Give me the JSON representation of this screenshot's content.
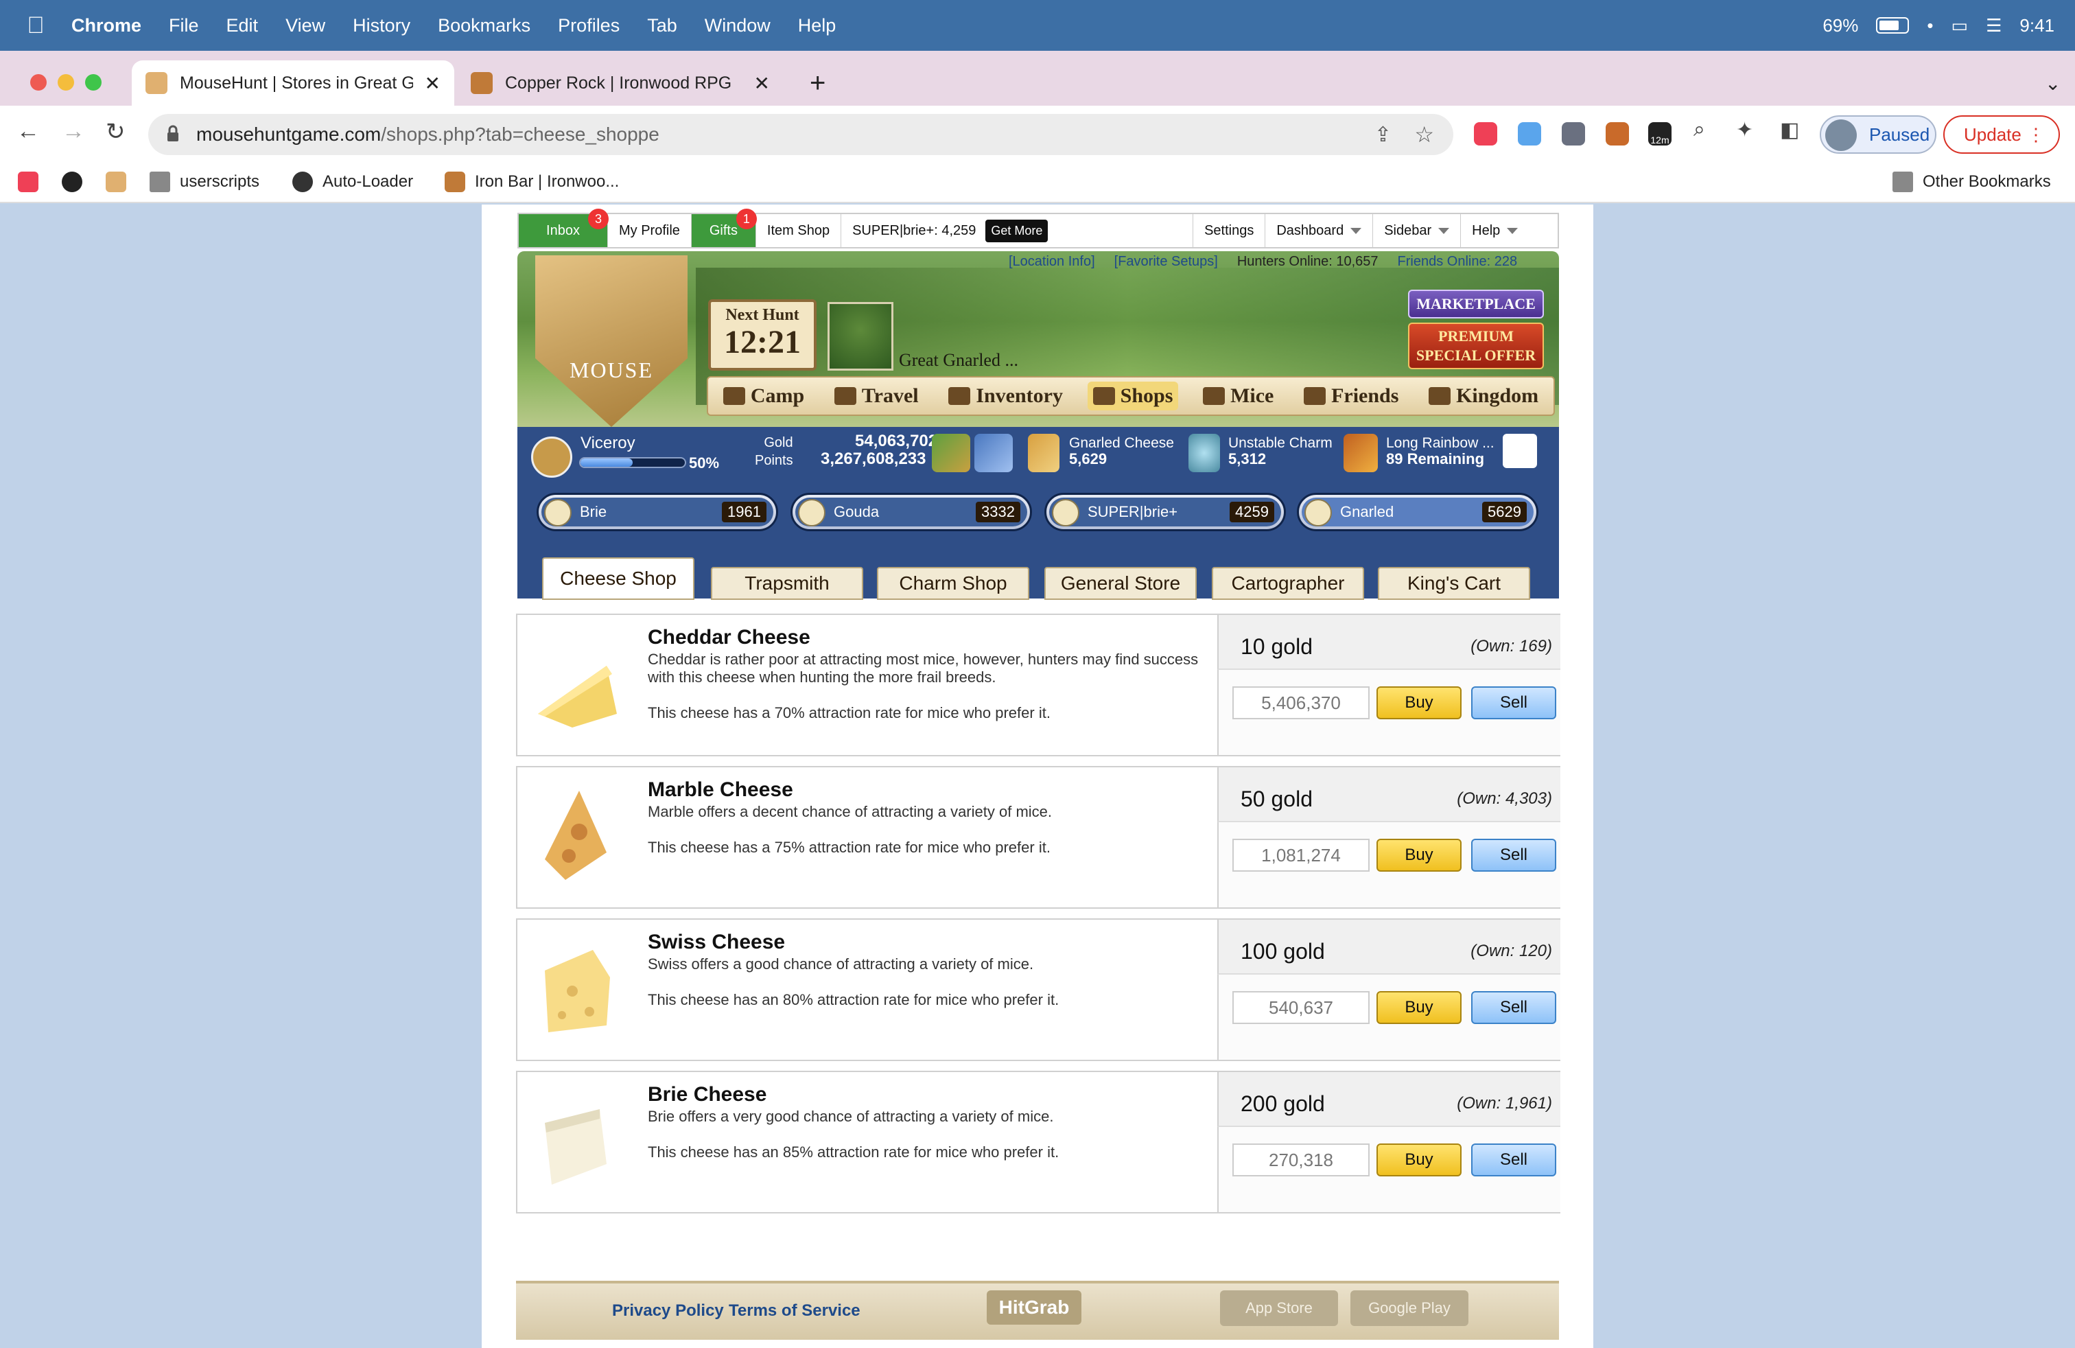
{
  "menubar": {
    "items": [
      "Chrome",
      "File",
      "Edit",
      "View",
      "History",
      "Bookmarks",
      "Profiles",
      "Tab",
      "Window",
      "Help"
    ],
    "battery": "69%",
    "time": "9:41"
  },
  "tabs": [
    {
      "title": "MouseHunt | Stores in Great Gr",
      "active": true
    },
    {
      "title": "Copper Rock | Ironwood RPG",
      "active": false
    }
  ],
  "toolbar": {
    "url_domain": "mousehuntgame.com",
    "url_path": "/shops.php?tab=cheese_shoppe",
    "paused_label": "Paused",
    "update_label": "Update",
    "ext_badge": "12m"
  },
  "bookmarks": [
    "userscripts",
    "Auto-Loader",
    "Iron Bar | Ironwoo...",
    "Other Bookmarks"
  ],
  "topnav": {
    "inbox": "Inbox",
    "inbox_badge": "3",
    "profile": "My Profile",
    "gifts": "Gifts",
    "gifts_badge": "1",
    "item_shop": "Item Shop",
    "superbrie": "SUPER|brie+: 4,259",
    "get_more": "Get More",
    "settings": "Settings",
    "dashboard": "Dashboard",
    "sidebar": "Sidebar",
    "help": "Help"
  },
  "infoline": {
    "location_info": "[Location Info]",
    "favorite_setups": "[Favorite Setups]",
    "hunters_online": "Hunters Online: 10,657",
    "friends_online": "Friends Online: 228"
  },
  "header": {
    "logo_text": "MOUSE",
    "next_hunt_label": "Next Hunt",
    "next_hunt_time": "12:21",
    "location": "Great Gnarled ...",
    "marketplace": "MARKETPLACE",
    "premium_line1": "PREMIUM",
    "premium_line2": "SPECIAL OFFER",
    "nav": [
      "Camp",
      "Travel",
      "Inventory",
      "Shops",
      "Mice",
      "Friends",
      "Kingdom"
    ]
  },
  "hud": {
    "rank": "Viceroy",
    "progress_pct": 50,
    "progress_label": "50%",
    "gold_label": "Gold",
    "points_label": "Points",
    "gold": "54,063,702",
    "points": "3,267,608,233",
    "bait_name": "Gnarled Cheese",
    "bait_count": "5,629",
    "charm_name": "Unstable Charm",
    "charm_count": "5,312",
    "trinket_name": "Long Rainbow ...",
    "trinket_remaining": "89 Remaining",
    "cheeses": [
      {
        "name": "Brie",
        "count": "1961"
      },
      {
        "name": "Gouda",
        "count": "3332"
      },
      {
        "name": "SUPER|brie+",
        "count": "4259"
      },
      {
        "name": "Gnarled",
        "count": "5629"
      }
    ]
  },
  "shop_tabs": [
    "Cheese Shop",
    "Trapsmith",
    "Charm Shop",
    "General Store",
    "Cartographer",
    "King's Cart"
  ],
  "items": [
    {
      "title": "Cheddar Cheese",
      "desc": "Cheddar is rather poor at attracting most mice, however, hunters may find success with this cheese when hunting the more frail breeds.",
      "attract": "This cheese has a 70% attraction rate for mice who prefer it.",
      "price": "10 gold",
      "own": "(Own: 169)",
      "qty": "5,406,370",
      "buy": "Buy",
      "sell": "Sell"
    },
    {
      "title": "Marble Cheese",
      "desc": "Marble offers a decent chance of attracting a variety of mice.",
      "attract": "This cheese has a 75% attraction rate for mice who prefer it.",
      "price": "50 gold",
      "own": "(Own: 4,303)",
      "qty": "1,081,274",
      "buy": "Buy",
      "sell": "Sell"
    },
    {
      "title": "Swiss Cheese",
      "desc": "Swiss offers a good chance of attracting a variety of mice.",
      "attract": "This cheese has an 80% attraction rate for mice who prefer it.",
      "price": "100 gold",
      "own": "(Own: 120)",
      "qty": "540,637",
      "buy": "Buy",
      "sell": "Sell"
    },
    {
      "title": "Brie Cheese",
      "desc": "Brie offers a very good chance of attracting a variety of mice.",
      "attract": "This cheese has an 85% attraction rate for mice who prefer it.",
      "price": "200 gold",
      "own": "(Own: 1,961)",
      "qty": "270,318",
      "buy": "Buy",
      "sell": "Sell"
    }
  ],
  "footer": {
    "privacy": "Privacy Policy",
    "terms": "Terms of Service",
    "hitgrab": "HitGrab",
    "appstore": "App Store",
    "googleplay": "Google Play"
  },
  "colors": {
    "menubar": "#3d6fa5",
    "hud": "#2f4e87",
    "buy": "#f0c020",
    "sell": "#8ec2f8"
  }
}
